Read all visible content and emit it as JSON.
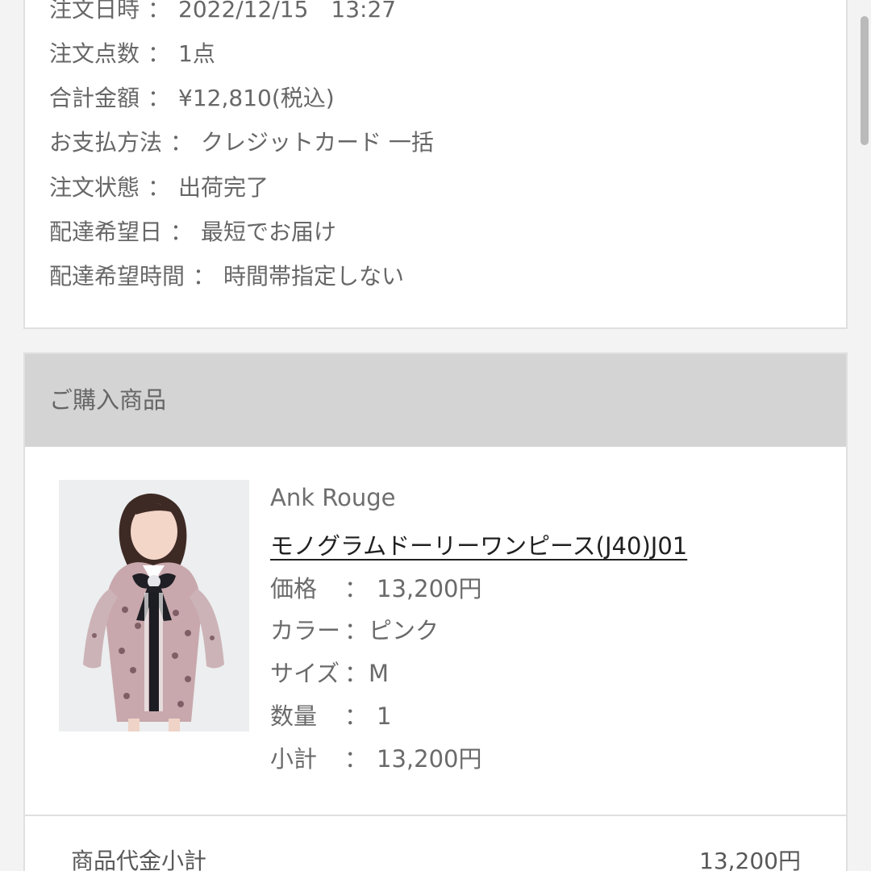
{
  "order_info": {
    "ordered_at_label": "注文日時",
    "ordered_at_value": "2022/12/15　13:27",
    "item_count_label": "注文点数",
    "item_count_value": "1点",
    "total_label": "合計金額",
    "total_value": "¥12,810(税込)",
    "payment_label": "お支払方法",
    "payment_value": "クレジットカード 一括",
    "status_label": "注文状態",
    "status_value": "出荷完了",
    "delivery_date_label": "配達希望日",
    "delivery_date_value": "最短でお届け",
    "delivery_time_label": "配達希望時間",
    "delivery_time_value": "時間帯指定しない",
    "separator": "："
  },
  "purchased_items": {
    "title": "ご購入商品",
    "product": {
      "brand": "Ank Rouge",
      "name": "モノグラムドーリーワンピース(J40)J01",
      "price_label": "価格",
      "price_value": "13,200円",
      "color_label": "カラー",
      "color_value": "ピンク",
      "size_label": "サイズ",
      "size_value": "M",
      "quantity_label": "数量",
      "quantity_value": "1",
      "subtotal_label": "小計",
      "subtotal_value": "13,200円",
      "separator": "："
    }
  },
  "summary": {
    "label": "商品代金小計",
    "value": "13,200円"
  },
  "colors": {
    "background": "#f3f3f3",
    "panel": "#ffffff",
    "header": "#d4d4d4",
    "text": "#676767",
    "link": "#202020"
  }
}
